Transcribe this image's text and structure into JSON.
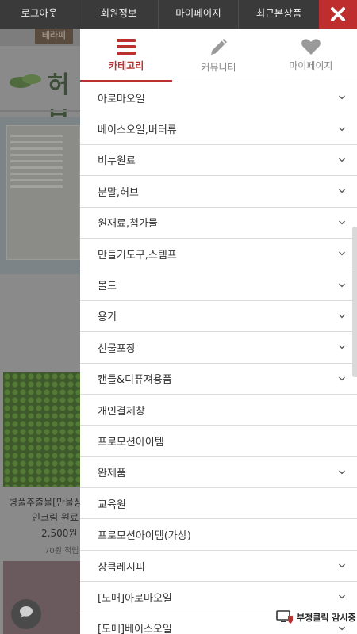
{
  "topbar": {
    "items": [
      "로그아웃",
      "회원정보",
      "마이페이지",
      "최근본상품"
    ],
    "close_icon": "close-x-icon"
  },
  "background": {
    "logo_text": "테라피",
    "brand_text": "허브",
    "product_name_1": "병풀추출물[만물상",
    "product_name_2": "인크림 원료",
    "price": "2,500원",
    "points": "70원 적립"
  },
  "tabs": [
    {
      "label": "카테고리",
      "icon": "menu-list-icon",
      "active": true
    },
    {
      "label": "커뮤니티",
      "icon": "pencil-icon",
      "active": false
    },
    {
      "label": "마이페이지",
      "icon": "heart-icon",
      "active": false
    }
  ],
  "categories": [
    "아로마오일",
    "베이스오일,버터류",
    "비누원료",
    "분말,허브",
    "원재료,첨가물",
    "만들기도구,스템프",
    "몰드",
    "용기",
    "선물포장",
    "캔들&디퓨져용품",
    "개인결제창",
    "프로모션아이템",
    "완제품",
    "교육원",
    "프로모션아이템(가상)",
    "상큼레시피",
    "[도매]아로마오일",
    "[도매]베이스오일"
  ],
  "chevron_rows": [
    0,
    1,
    2,
    3,
    4,
    5,
    6,
    7,
    8,
    9,
    12,
    15,
    16,
    17
  ],
  "fraud_badge": {
    "text": "부정클릭 감시중",
    "icon": "monitor-shield-icon"
  },
  "colors": {
    "accent": "#b93131",
    "topbar": "#3a3a3a",
    "close": "#bf2e2e"
  }
}
